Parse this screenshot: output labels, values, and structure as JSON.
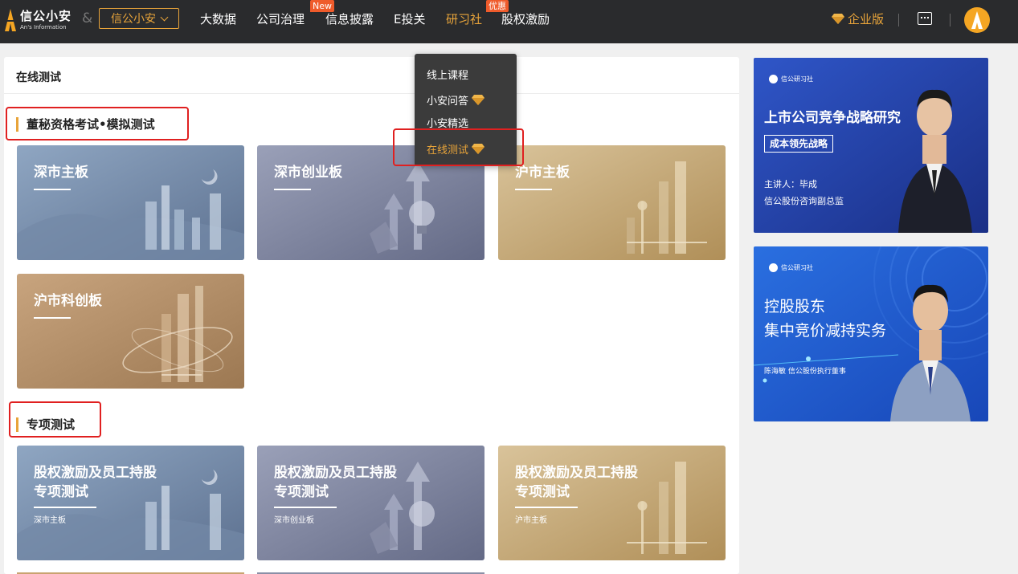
{
  "brand": {
    "name_cn": "信公小安",
    "name_en": "An's Information",
    "amp": "&"
  },
  "switcher": {
    "label": "信公小安"
  },
  "nav": [
    {
      "label": "大数据",
      "badge": ""
    },
    {
      "label": "公司治理",
      "badge": "New"
    },
    {
      "label": "信息披露",
      "badge": ""
    },
    {
      "label": "E投关",
      "badge": ""
    },
    {
      "label": "研习社",
      "badge": "优惠",
      "active": true
    },
    {
      "label": "股权激励",
      "badge": ""
    }
  ],
  "header_right": {
    "edition": "企业版"
  },
  "dropdown": {
    "items": [
      {
        "label": "线上课程",
        "gem": false
      },
      {
        "label": "小安问答",
        "gem": true
      },
      {
        "label": "小安精选",
        "gem": false
      },
      {
        "label": "在线测试",
        "gem": true,
        "active": true
      }
    ]
  },
  "panel": {
    "title": "在线测试",
    "section1": {
      "title": "董秘资格考试•模拟测试",
      "cards": [
        {
          "title": "深市主板",
          "theme": "blue"
        },
        {
          "title": "深市创业板",
          "theme": "slate"
        },
        {
          "title": "沪市主板",
          "theme": "gold"
        },
        {
          "title": "沪市科创板",
          "theme": "bronze"
        }
      ]
    },
    "section2": {
      "title": "专项测试",
      "cards": [
        {
          "title_line1": "股权激励及员工持股",
          "title_line2": "专项测试",
          "sub": "深市主板",
          "theme": "blue"
        },
        {
          "title_line1": "股权激励及员工持股",
          "title_line2": "专项测试",
          "sub": "深市创业板",
          "theme": "slate"
        },
        {
          "title_line1": "股权激励及员工持股",
          "title_line2": "专项测试",
          "sub": "沪市主板",
          "theme": "gold"
        }
      ]
    }
  },
  "ads": [
    {
      "brand": "信公研习社",
      "title": "上市公司竞争战略研究",
      "tag": "成本领先战略",
      "speaker": "主讲人：毕成",
      "role": "信公股份咨询副总监"
    },
    {
      "brand": "信公研习社",
      "title_line1": "控股股东",
      "title_line2": "集中竞价减持实务",
      "speaker": "陈海敏 信公股份执行董事"
    }
  ],
  "colors": {
    "accent": "#e8a43a",
    "badge": "#ef5b2b",
    "highlight_box": "#e02020",
    "topbar": "#2a2b2d"
  }
}
